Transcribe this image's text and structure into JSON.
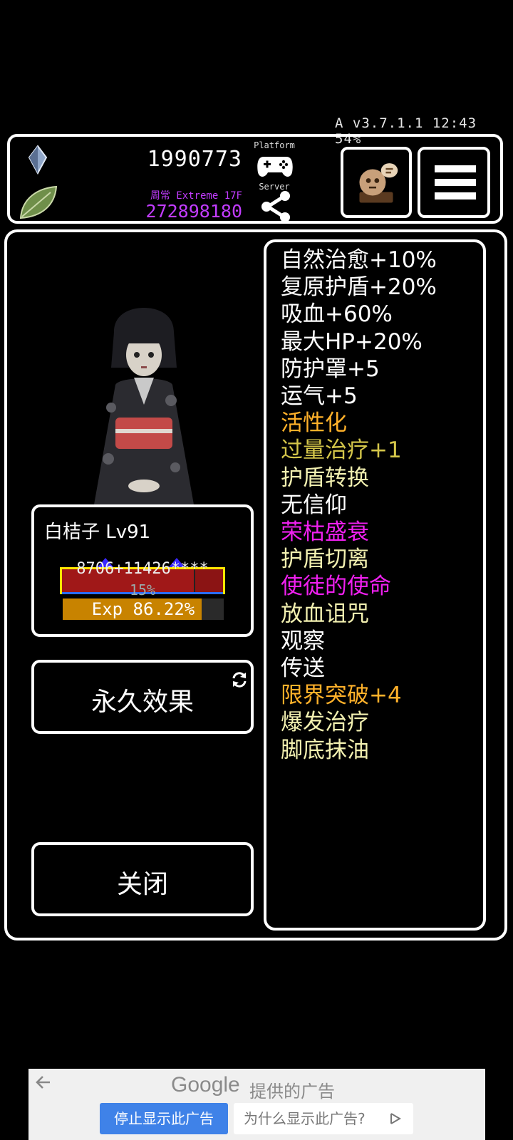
{
  "status_bar": {
    "text": "A v3.7.1.1 12:43 54%"
  },
  "header": {
    "gold": "1990773",
    "difficulty": "周常 Extreme 17F",
    "souls": "272898180",
    "platform_label": "Platform",
    "server_label": "Server",
    "icons": [
      "crystal-icon",
      "leaf-icon",
      "gamepad-icon",
      "share-icon",
      "ghost-icon",
      "menu-icon"
    ]
  },
  "character": {
    "name": "白桔子 Lv91",
    "hp_text": "8706+11426****",
    "hp_fraction": 0.82,
    "shield_pct": "15%",
    "exp_text": "Exp 86.22%",
    "exp_fraction": 0.8622
  },
  "buttons": {
    "permanent_effects": "永久效果",
    "close": "关闭"
  },
  "skills": [
    {
      "label": "自然治愈+10%",
      "color": "#ffffff"
    },
    {
      "label": "复原护盾+20%",
      "color": "#ffffff"
    },
    {
      "label": "吸血+60%",
      "color": "#ffffff"
    },
    {
      "label": "最大HP+20%",
      "color": "#ffffff"
    },
    {
      "label": "防护罩+5",
      "color": "#ffffff"
    },
    {
      "label": "运气+5",
      "color": "#ffffff"
    },
    {
      "label": "活性化",
      "color": "#ffb12a"
    },
    {
      "label": "过量治疗+1",
      "color": "#d4c64a"
    },
    {
      "label": "护盾转换",
      "color": "#f2f0b0"
    },
    {
      "label": "无信仰",
      "color": "#ffffff"
    },
    {
      "label": "荣枯盛衰",
      "color": "#f020f0"
    },
    {
      "label": "护盾切离",
      "color": "#f2f0b0"
    },
    {
      "label": "使徒的使命",
      "color": "#f020f0"
    },
    {
      "label": "放血诅咒",
      "color": "#f2f0b0"
    },
    {
      "label": "观察",
      "color": "#ffffff"
    },
    {
      "label": "传送",
      "color": "#ffffff"
    },
    {
      "label": "限界突破+4",
      "color": "#ffb12a"
    },
    {
      "label": "爆发治疗",
      "color": "#f2f0b0"
    },
    {
      "label": "脚底抹油",
      "color": "#f2f0b0"
    }
  ],
  "ad": {
    "brand": "Google",
    "provided_by": "提供的广告",
    "stop_label": "停止显示此广告",
    "why_label": "为什么显示此广告?"
  }
}
